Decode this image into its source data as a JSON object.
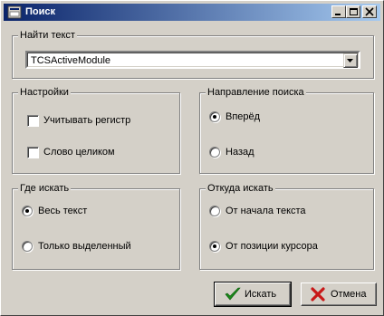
{
  "window": {
    "title": "Поиск",
    "controls": [
      "minimize-icon",
      "maximize-icon",
      "close-icon"
    ]
  },
  "find_group": {
    "legend": "Найти текст",
    "combo_value": "TCSActiveModule"
  },
  "settings_group": {
    "legend": "Настройки",
    "options": [
      {
        "label": "Учитывать регистр",
        "checked": false
      },
      {
        "label": "Слово целиком",
        "checked": false
      }
    ]
  },
  "direction_group": {
    "legend": "Направление поиска",
    "options": [
      {
        "label": "Вперёд",
        "selected": true
      },
      {
        "label": "Назад",
        "selected": false
      }
    ]
  },
  "scope_group": {
    "legend": "Где искать",
    "options": [
      {
        "label": "Весь текст",
        "selected": true
      },
      {
        "label": "Только выделенный",
        "selected": false
      }
    ]
  },
  "origin_group": {
    "legend": "Откуда искать",
    "options": [
      {
        "label": "От начала текста",
        "selected": false
      },
      {
        "label": "От позиции курсора",
        "selected": true
      }
    ]
  },
  "buttons": {
    "search_label": "Искать",
    "search_icon": "checkmark-icon",
    "cancel_label": "Отмена",
    "cancel_icon": "red-x-icon"
  },
  "colors": {
    "title_start": "#0a246a",
    "title_end": "#a6caf0",
    "face": "#d4d0c8",
    "check_green": "#1a8a1a",
    "cancel_red": "#c81818"
  }
}
